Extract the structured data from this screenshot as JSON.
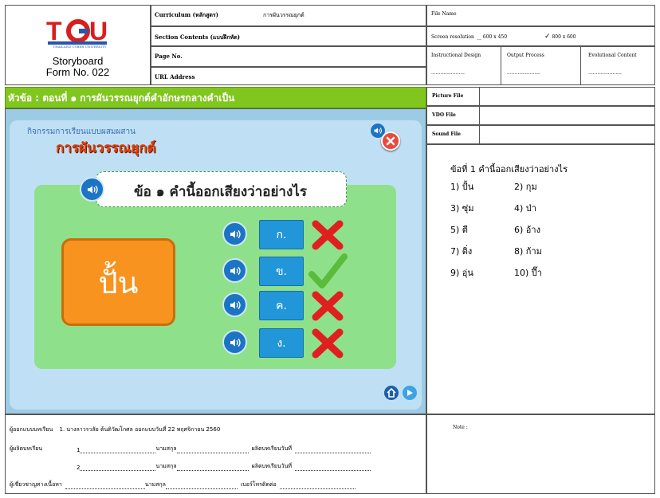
{
  "header": {
    "logo_text": "TCU",
    "logo_subtitle": "THAILAND CYBER UNIVERSITY",
    "title_line1": "Storyboard",
    "title_line2": "Form No. 022",
    "curriculum_label": "Curriculum (หลักสูตร)",
    "curriculum_value": "การผันวรรณยุกต์",
    "section_label": "Section Contents (แบบฝึกหัด)",
    "page_label": "Page No.",
    "url_label": "URL Address",
    "file_name_label": "File Name",
    "screen_res_label": "Screen resolution",
    "res_option_1": "600 x 450",
    "res_option_2": "800 x 600",
    "res_check": "✓",
    "instructional_label": "Instructional Design",
    "output_label": "Output Process",
    "evolutional_label": "Evolutional Content",
    "dots": "......................"
  },
  "topic": "หัวข้อ : ตอนที่ ๑ การผันวรรณยุกต์คำอักษรกลางคำเป็น",
  "side_labels": {
    "picture": "Picture File",
    "vdo": "VDO File",
    "sound": "Sound File"
  },
  "lesson": {
    "activity": "กิจกรรมการเรียนแบบผสมผสาน",
    "title": "การผันวรรณยุกต์",
    "question": "ข้อ ๑ คำนี้ออกเสียงว่าอย่างไร",
    "word": "ปั้น",
    "choices": [
      "ก.",
      "ข.",
      "ค.",
      "ง."
    ],
    "marks": [
      "wrong",
      "correct",
      "wrong",
      "wrong"
    ]
  },
  "sound_panel": {
    "question": "ข้อที่ 1 คำนี้ออกเสียงว่าอย่างไร",
    "items": [
      "1) ปั้น",
      "2) กุม",
      "3) ซุ่ม",
      "4) ป่า",
      "5) ตี",
      "6) อ้าง",
      "7) ติ่ง",
      "8) ก้าม",
      "9) อุ่น",
      "10) ปี๊า"
    ]
  },
  "footer": {
    "designer_label": "ผู้ออกแบบบทเรียน",
    "designer_value": "1. นางลาวรวลัย ต้นติวัฒโกศล ออกแบบวันที่ 22 พฤศจิกายน 2560",
    "producer_label": "ผู้ผลิตบทเรียน",
    "producer_1": "1",
    "producer_2": "2",
    "expert_label": "ผู้เชี่ยวชาญทางเนื้อหา",
    "surname_label": "นามสกุล",
    "produce_date_label": "ผลิตบทเรียนวันที่",
    "phone_label": "เบอร์โทรติดต่อ",
    "note_label": "Note :"
  }
}
